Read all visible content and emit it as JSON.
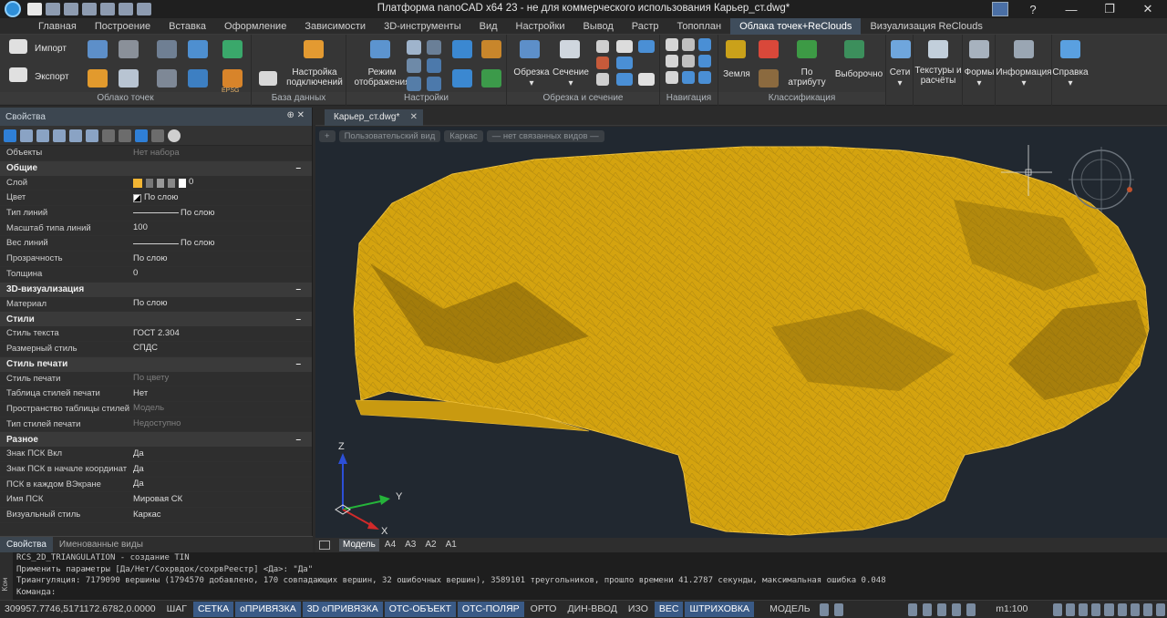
{
  "window": {
    "title": "Платформа nanoCAD x64 23 - не для коммерческого использования Карьер_ст.dwg*",
    "controls": [
      "?",
      "—",
      "❐",
      "✕"
    ]
  },
  "ribbon_tabs": [
    {
      "label": "Главная",
      "active": false
    },
    {
      "label": "Построение",
      "active": false
    },
    {
      "label": "Вставка",
      "active": false
    },
    {
      "label": "Оформление",
      "active": false
    },
    {
      "label": "Зависимости",
      "active": false
    },
    {
      "label": "3D-инструменты",
      "active": false
    },
    {
      "label": "Вид",
      "active": false
    },
    {
      "label": "Настройки",
      "active": false
    },
    {
      "label": "Вывод",
      "active": false
    },
    {
      "label": "Растр",
      "active": false
    },
    {
      "label": "Топоплан",
      "active": false
    },
    {
      "label": "Облака точек+ReClouds",
      "active": true
    },
    {
      "label": "Визуализация ReClouds",
      "active": false
    }
  ],
  "ribbon": {
    "import_label": "Импорт",
    "export_label": "Экспорт",
    "epsg_label": "EPSG",
    "panel_cloud": "Облако точек",
    "conn_settings_l1": "Настройка",
    "conn_settings_l2": "подключений",
    "panel_db": "База данных",
    "display_mode_l1": "Режим",
    "display_mode_l2": "отображения",
    "panel_settings": "Настройки",
    "crop_label": "Обрезка",
    "section_label": "Сечение",
    "panel_crop": "Обрезка и сечение",
    "panel_nav": "Навигация",
    "ground_label": "Земля",
    "by_attr_l1": "По",
    "by_attr_l2": "атрибуту",
    "selective_label": "Выборочно",
    "panel_class": "Классификация",
    "nets_label": "Сети",
    "textures_l1": "Текстуры и",
    "textures_l2": "расчёты",
    "forms_label": "Формы",
    "info_label": "Информация",
    "help_label": "Справка"
  },
  "properties": {
    "header": "Свойства",
    "header_ctl": "⊕ ✕",
    "objects_key": "Объекты",
    "objects_val": "Нет набора",
    "sections": [
      {
        "title": "Общие",
        "rows": [
          {
            "k": "Слой",
            "v": "0",
            "type": "layer"
          },
          {
            "k": "Цвет",
            "v": "По слою",
            "type": "color"
          },
          {
            "k": "Тип линий",
            "v": "По слою",
            "type": "line"
          },
          {
            "k": "Масштаб типа линий",
            "v": "100",
            "type": "text"
          },
          {
            "k": "Вес линий",
            "v": "По слою",
            "type": "line"
          },
          {
            "k": "Прозрачность",
            "v": "По слою",
            "type": "text"
          },
          {
            "k": "Толщина",
            "v": "0",
            "type": "text"
          }
        ]
      },
      {
        "title": "3D-визуализация",
        "rows": [
          {
            "k": "Материал",
            "v": "По слою",
            "type": "text"
          }
        ]
      },
      {
        "title": "Стили",
        "rows": [
          {
            "k": "Стиль текста",
            "v": "ГОСТ 2.304",
            "type": "text"
          },
          {
            "k": "Размерный стиль",
            "v": "СПДС",
            "type": "text"
          }
        ]
      },
      {
        "title": "Стиль печати",
        "rows": [
          {
            "k": "Стиль печати",
            "v": "По цвету",
            "type": "muted"
          },
          {
            "k": "Таблица стилей печати",
            "v": "Нет",
            "type": "text"
          },
          {
            "k": "Пространство таблицы стилей п...",
            "v": "Модель",
            "type": "muted"
          },
          {
            "k": "Тип стилей печати",
            "v": "Недоступно",
            "type": "muted"
          }
        ]
      },
      {
        "title": "Разное",
        "rows": [
          {
            "k": "Знак ПСК Вкл",
            "v": "Да",
            "type": "text"
          },
          {
            "k": "Знак ПСК в начале координат",
            "v": "Да",
            "type": "text"
          },
          {
            "k": "ПСК в каждом ВЭкране",
            "v": "Да",
            "type": "text"
          },
          {
            "k": "Имя ПСК",
            "v": "Мировая СК",
            "type": "text"
          },
          {
            "k": "Визуальный стиль",
            "v": "Каркас",
            "type": "text"
          }
        ]
      }
    ],
    "collapse_glyph": "–",
    "tabs": [
      "Свойства",
      "Именованные виды"
    ]
  },
  "document": {
    "tab_label": "Карьер_ст.dwg*",
    "close_glyph": "✕",
    "view_pills": [
      "+",
      "Пользовательский вид",
      "Каркас",
      "— нет связанных видов —"
    ],
    "axis_x": "X",
    "axis_y": "Y",
    "axis_z": "Z"
  },
  "layouts": [
    "Модель",
    "A4",
    "A3",
    "A2",
    "A1"
  ],
  "command_line": {
    "side_label": "Ком",
    "lines": [
      "RCS_2D_TRIANGULATION - создание TIN",
      "Применить параметры [Да/Нет/Сохрвдок/сохрвРеестр] <Да>: \"Да\"",
      "Триангуляция: 7179090 вершины (1794570 добавлено, 170 совпадающих вершин, 32 ошибочных вершин), 3589101 треугольников, прошло времени 41.2787 секунды, максимальная ошибка 0.048",
      "Команда:"
    ]
  },
  "status_bar": {
    "coords": "309957.7746,5171172.6782,0.0000",
    "toggles": [
      {
        "label": "ШАГ",
        "on": false
      },
      {
        "label": "СЕТКА",
        "on": true
      },
      {
        "label": "оПРИВЯЗКА",
        "on": true
      },
      {
        "label": "3D оПРИВЯЗКА",
        "on": true
      },
      {
        "label": "ОТС-ОБЪЕКТ",
        "on": true
      },
      {
        "label": "ОТС-ПОЛЯР",
        "on": true
      },
      {
        "label": "ОРТО",
        "on": false
      },
      {
        "label": "ДИН-ВВОД",
        "on": false
      },
      {
        "label": "ИЗО",
        "on": false
      },
      {
        "label": "ВЕС",
        "on": true
      },
      {
        "label": "ШТРИХОВКА",
        "on": true
      }
    ],
    "model_label": "МОДЕЛЬ",
    "scale": "m1:100"
  },
  "colors": {
    "mesh": "#d4a30f",
    "mesh_edge": "#f0c13a",
    "viewport_bg": "#212830",
    "accent": "#3f4d5c"
  }
}
